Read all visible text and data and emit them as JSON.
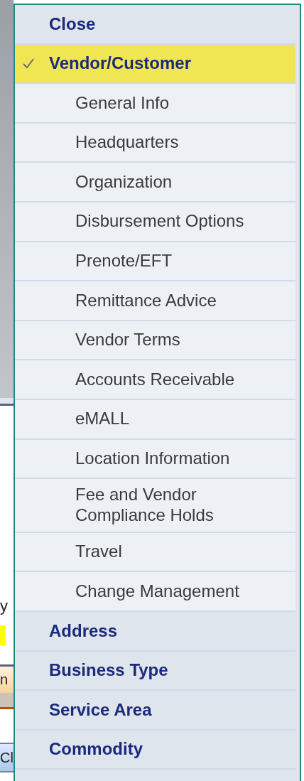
{
  "background_window": {
    "text_1": "y",
    "header_text": "n",
    "button_text": "Cl"
  },
  "menu": {
    "items": [
      {
        "label": "Close",
        "selected": false
      },
      {
        "label": "Vendor/Customer",
        "selected": true,
        "children": [
          {
            "label": "General Info",
            "selected": false
          },
          {
            "label": "Headquarters",
            "selected": false
          },
          {
            "label": "Organization",
            "selected": false
          },
          {
            "label": "Disbursement Options",
            "selected": false
          },
          {
            "label": "Prenote/EFT",
            "selected": false
          },
          {
            "label": "Remittance Advice",
            "selected": false
          },
          {
            "label": "Vendor Terms",
            "selected": false
          },
          {
            "label": "Accounts Receivable",
            "selected": false
          },
          {
            "label": "eMALL",
            "selected": false
          },
          {
            "label": "Location Information",
            "selected": false
          },
          {
            "label": "Fee and Vendor Compliance Holds",
            "selected": false
          },
          {
            "label": "Travel",
            "selected": false
          },
          {
            "label": "Change Management",
            "selected": false
          }
        ]
      },
      {
        "label": "Address",
        "selected": false
      },
      {
        "label": "Business Type",
        "selected": false
      },
      {
        "label": "Service Area",
        "selected": false
      },
      {
        "label": "Commodity",
        "selected": false
      }
    ]
  }
}
